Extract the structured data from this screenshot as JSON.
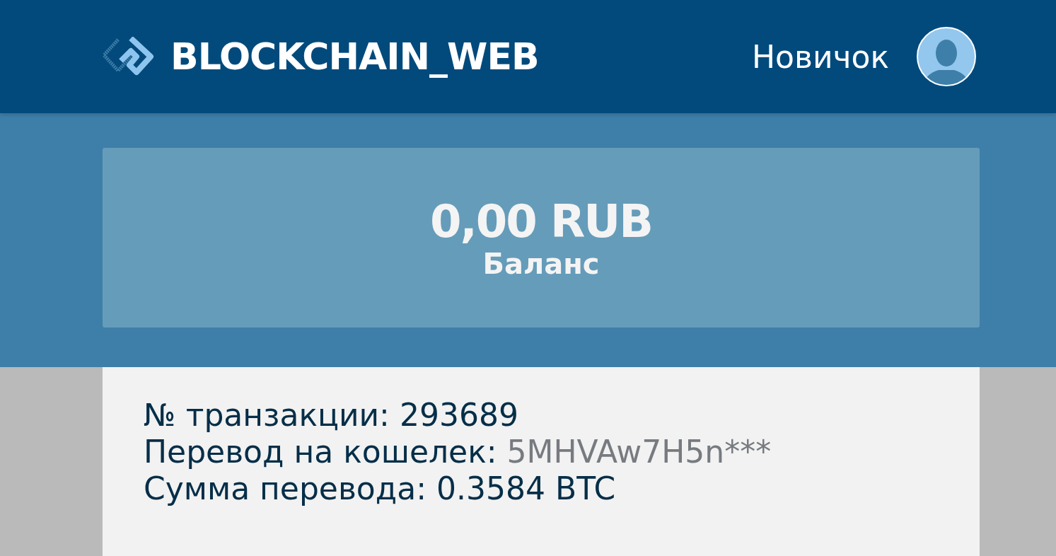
{
  "header": {
    "logo": "BLOCKCHAIN_WEB",
    "user_name": "Новичок"
  },
  "balance": {
    "amount": "0,00 RUB",
    "label": "Баланс"
  },
  "transaction": [
    {
      "label": "№ транзакции:",
      "value": "293689",
      "kind": "plain"
    },
    {
      "label": "Перевод на кошелек:",
      "value": "5MHVAw7H5n***",
      "kind": "muted"
    },
    {
      "label": "Сумма перевода:",
      "value": "0.3584 BTC",
      "kind": "plain"
    }
  ]
}
